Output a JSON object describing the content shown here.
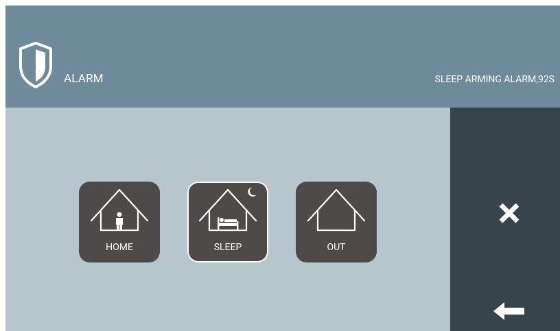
{
  "header": {
    "title": "ALARM",
    "status": "SLEEP ARMING ALARM,92S",
    "icon": "shield-icon"
  },
  "modes": [
    {
      "label": "HOME",
      "icon": "home-person-icon",
      "selected": false
    },
    {
      "label": "SLEEP",
      "icon": "home-sleep-icon",
      "selected": true
    },
    {
      "label": "OUT",
      "icon": "home-empty-icon",
      "selected": false
    }
  ],
  "side": {
    "close_icon": "close-icon",
    "back_icon": "back-arrow-icon"
  },
  "colors": {
    "header_bg": "#6e8a9b",
    "main_bg": "#b7c5cc",
    "side_bg": "#37444c",
    "button_bg": "#4d4a4a",
    "text": "#ffffff"
  }
}
